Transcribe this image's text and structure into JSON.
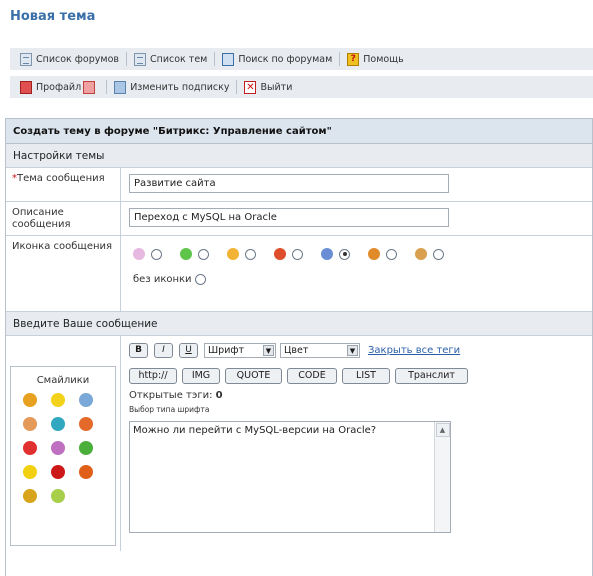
{
  "page": {
    "title": "Новая тема"
  },
  "toolbar": {
    "row1": [
      {
        "label": "Список форумов",
        "icon": "forum-list-icon"
      },
      {
        "label": "Список тем",
        "icon": "topic-list-icon"
      },
      {
        "label": "Поиск по форумам",
        "icon": "search-icon"
      },
      {
        "label": "Помощь",
        "icon": "help-icon"
      }
    ],
    "row2": [
      {
        "label": "Профайл",
        "icon": "profile-icon"
      },
      {
        "label": "Изменить подписку",
        "icon": "subscription-icon"
      },
      {
        "label": "Выйти",
        "icon": "exit-icon"
      }
    ]
  },
  "form": {
    "header": "Создать тему в форуме \"Битрикс: Управление сайтом\"",
    "settings_section": "Настройки темы",
    "topic_label": "Тема сообщения",
    "topic_value": "Развитие сайта",
    "desc_label": "Описание сообщения",
    "desc_value": "Переход с MySQL на Oracle",
    "icon_label": "Иконка сообщения",
    "icon_options": [
      {
        "color": "#e7b8e0",
        "selected": false
      },
      {
        "color": "#5ec44a",
        "selected": false
      },
      {
        "color": "#f2b233",
        "selected": false
      },
      {
        "color": "#e04d2a",
        "selected": false
      },
      {
        "color": "#6a8ed6",
        "selected": true
      },
      {
        "color": "#e08a2a",
        "selected": false
      },
      {
        "color": "#d9a050",
        "selected": false
      }
    ],
    "no_icon_label": "без иконки",
    "message_section": "Введите Ваше сообщение"
  },
  "smilies": {
    "title": "Смайлики",
    "items": [
      {
        "name": "smile-icon",
        "color": "#e8a020"
      },
      {
        "name": "wink-icon",
        "color": "#f3d21b"
      },
      {
        "name": "grin-icon",
        "color": "#7aa8d8"
      },
      {
        "name": "laugh-icon",
        "color": "#e49a58"
      },
      {
        "name": "cool-icon",
        "color": "#2fa8c0"
      },
      {
        "name": "tongue-icon",
        "color": "#e46a2a"
      },
      {
        "name": "angry-icon",
        "color": "#e03030"
      },
      {
        "name": "sad-icon",
        "color": "#c070c0"
      },
      {
        "name": "sick-icon",
        "color": "#4cae3a"
      },
      {
        "name": "confused-icon",
        "color": "#f1d010"
      },
      {
        "name": "exclaim-icon",
        "color": "#cc1818"
      },
      {
        "name": "question-icon",
        "color": "#e0601a"
      },
      {
        "name": "surprise-icon",
        "color": "#d7a41c"
      },
      {
        "name": "idea-icon",
        "color": "#a8cf4a"
      }
    ]
  },
  "editor": {
    "format_buttons": [
      "B",
      "I",
      "U"
    ],
    "font_select": "Шрифт",
    "color_select": "Цвет",
    "close_tags": "Закрыть все теги",
    "tag_buttons": [
      "http://",
      "IMG",
      "QUOTE",
      "CODE",
      "LIST",
      "Транслит"
    ],
    "open_tags_label": "Открытые тэги:",
    "open_tags_value": "0",
    "font_hint": "Выбор типа шрифта",
    "message": "Можно ли перейти с MySQL-верcии на Oracle?"
  }
}
